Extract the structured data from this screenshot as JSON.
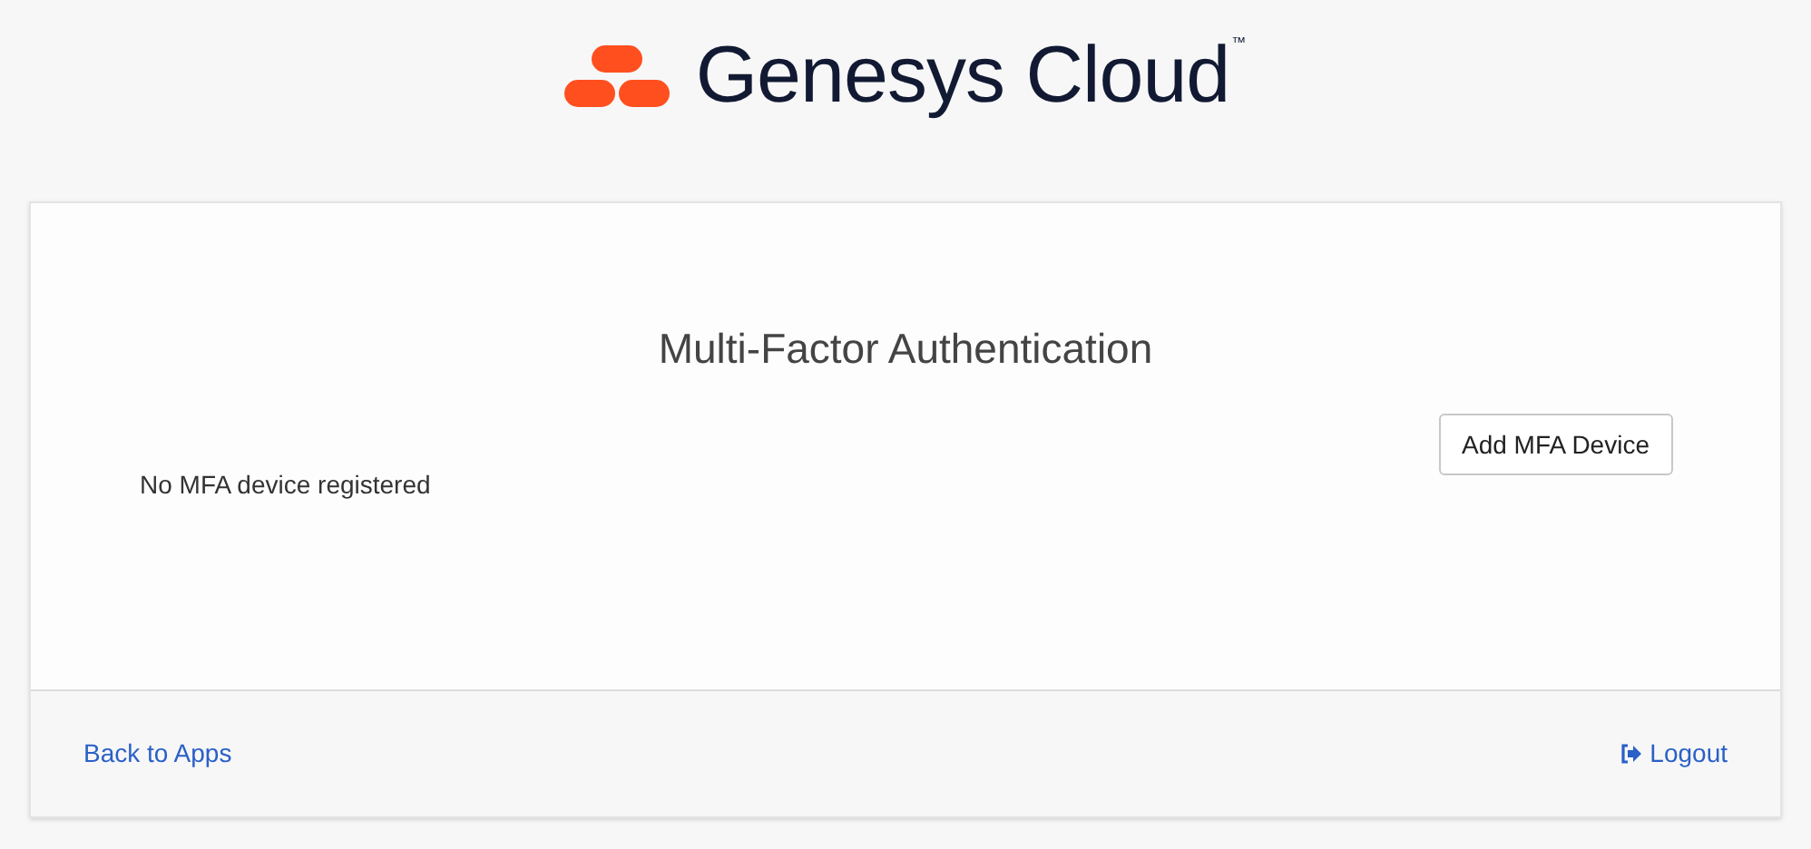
{
  "logo": {
    "name": "Genesys Cloud",
    "trademark": "™"
  },
  "card": {
    "title": "Multi-Factor Authentication",
    "button": "Add MFA Device",
    "message": "No MFA device registered"
  },
  "footer": {
    "back_link": "Back to Apps",
    "logout": "Logout"
  }
}
